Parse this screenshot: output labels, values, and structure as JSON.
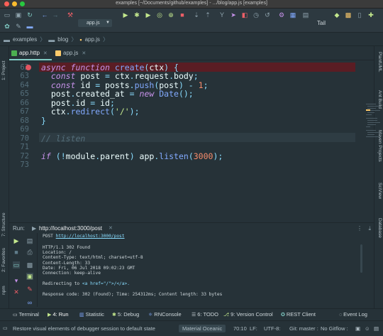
{
  "window": {
    "title": "examples [~/Documents/github/examples] - .../blog/app.js [examples]"
  },
  "toolbar": {
    "run_config": "app.js",
    "tail_label": "Tail"
  },
  "breadcrumb": [
    "examples",
    "blog",
    "app.js"
  ],
  "editor_tabs": [
    {
      "label": "app.http",
      "active": true
    },
    {
      "label": "app.js",
      "active": false
    }
  ],
  "editor": {
    "line_numbers": [
      "62",
      "63",
      "64",
      "65",
      "66",
      "67",
      "68",
      "69",
      "70",
      "71",
      "72",
      "73"
    ]
  },
  "sidebars": {
    "left": [
      "1: Project",
      "7: Structure",
      "2: Favorites",
      "npm"
    ],
    "right": [
      "PlantUML",
      "Ant Build",
      "Maven Projects",
      "SciView",
      "Database"
    ]
  },
  "run_panel": {
    "label": "Run:",
    "tab": "http://localhost:3000/post",
    "console": {
      "request_method": "POST",
      "request_url": "http://localhost:3000/post",
      "lines": [
        "HTTP/1.1 302 Found",
        "Location: /",
        "Content-Type: text/html; charset=utf-8",
        "Content-Length: 33",
        "Date: Fri, 06 Jul 2018 09:02:23 GMT",
        "Connection: keep-alive"
      ],
      "redirect_prefix": "Redirecting to ",
      "redirect_markup": "<a href=\"/\">/</a>.",
      "summary": "Response code: 302 (Found); Time: 254312ms; Content length: 33 bytes"
    }
  },
  "tool_tabs": [
    {
      "label": "Terminal",
      "active": false
    },
    {
      "label": "4: Run",
      "active": true
    },
    {
      "label": "Statistic",
      "active": false
    },
    {
      "label": "5: Debug",
      "active": false
    },
    {
      "label": "RNConsole",
      "active": false
    },
    {
      "label": "6: TODO",
      "active": false
    },
    {
      "label": "9: Version Control",
      "active": false
    },
    {
      "label": "REST Client",
      "active": false
    },
    {
      "label": "Event Log",
      "active": false
    }
  ],
  "status": {
    "message": "Restore visual elements of debugger session to default state",
    "theme": "Material Oceanic",
    "position": "70:10",
    "line_ending": "LF:",
    "encoding": "UTF-8:",
    "vcs": "Git: master :",
    "gitflow": "No Gitflow :"
  },
  "colors": {
    "background": "#263238",
    "accent": "#80cbc4",
    "breakpoint": "#e05561",
    "keyword": "#c792ea",
    "string": "#c3e88d",
    "number": "#f78c6c"
  }
}
